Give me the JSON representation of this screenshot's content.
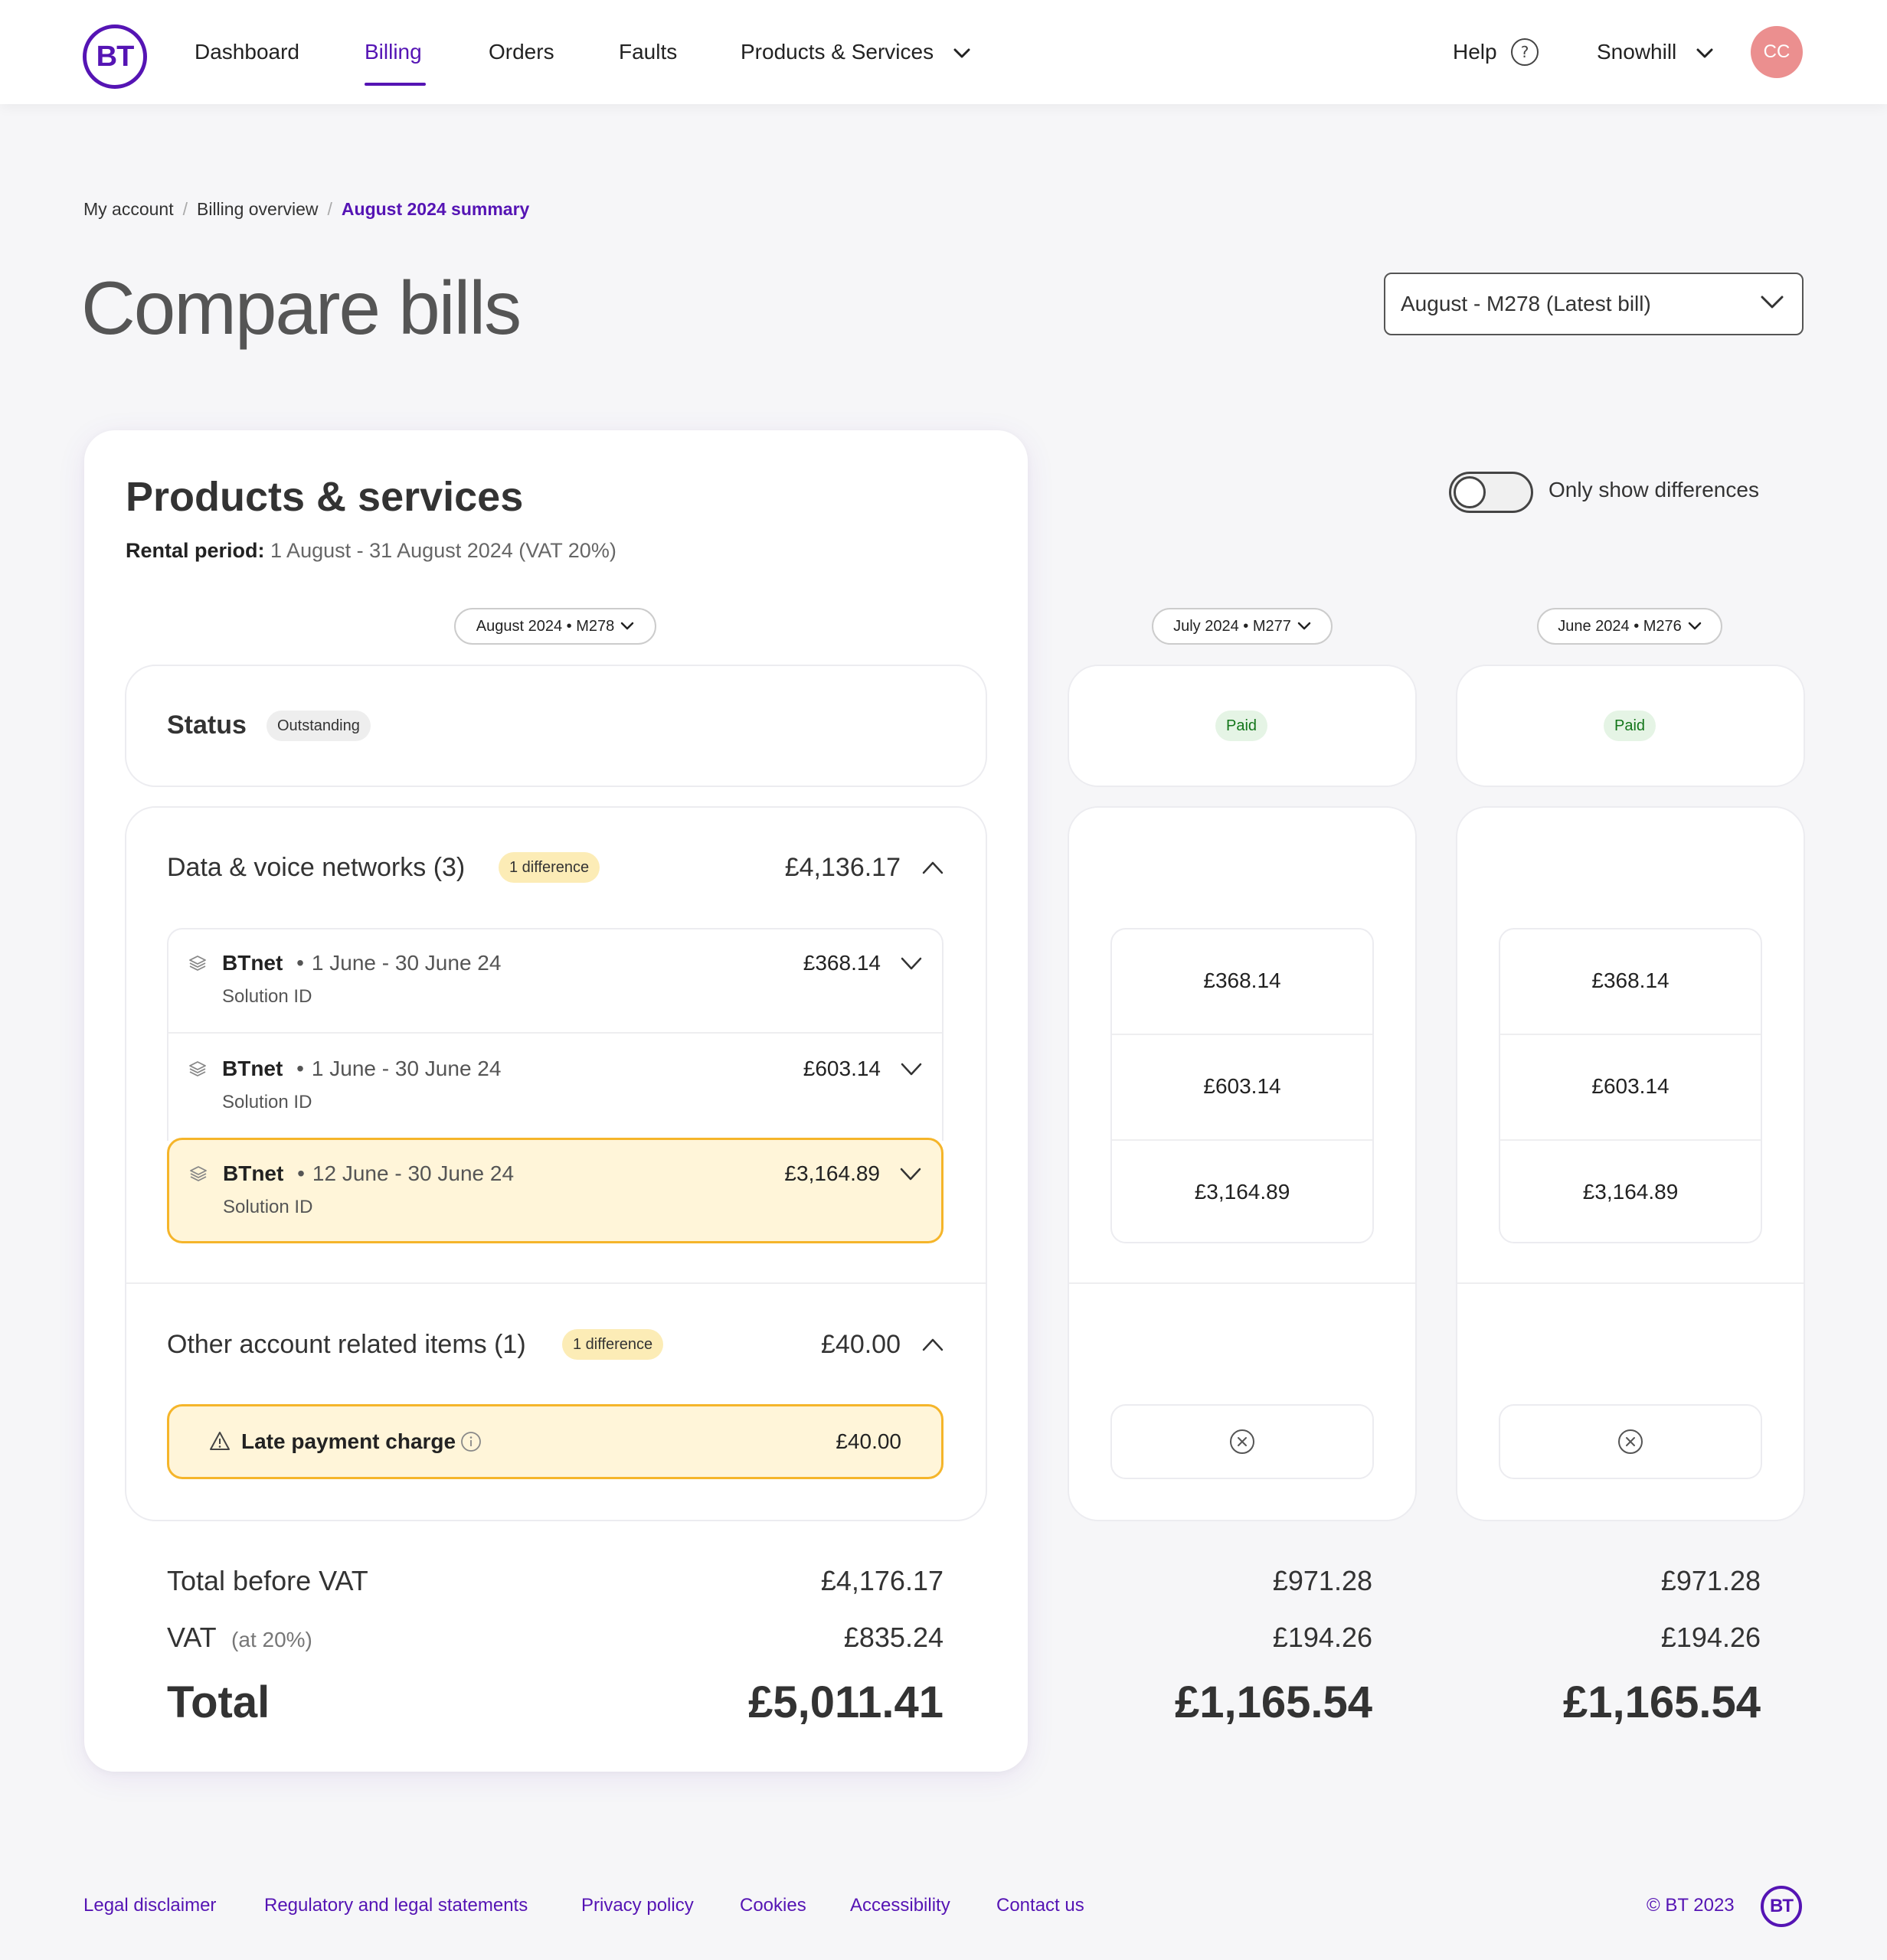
{
  "header": {
    "logo": "BT",
    "nav": [
      {
        "label": "Dashboard"
      },
      {
        "label": "Billing"
      },
      {
        "label": "Orders"
      },
      {
        "label": "Faults"
      },
      {
        "label": "Products & Services"
      }
    ],
    "help": "Help",
    "account": "Snowhill",
    "avatar_initials": "CC",
    "brand_color": "#5514b4"
  },
  "breadcrumb": {
    "items": [
      "My account",
      "Billing overview"
    ],
    "current": "August 2024 summary"
  },
  "page": {
    "title": "Compare bills",
    "bill_select": "August - M278 (Latest bill)"
  },
  "products": {
    "title": "Products & services",
    "rental_label": "Rental period:",
    "rental_value": "1 August - 31 August 2024 (VAT 20%)",
    "toggle_label": "Only show differences",
    "toggle_on": false
  },
  "columns": [
    {
      "label": "August 2024 • M278",
      "status": "Outstanding"
    },
    {
      "label": "July 2024 • M277",
      "status": "Paid"
    },
    {
      "label": "June 2024 • M276",
      "status": "Paid"
    }
  ],
  "status_label": "Status",
  "data_voice": {
    "title": "Data & voice networks (3)",
    "badge": "1 difference",
    "total": "£4,136.17",
    "items": [
      {
        "name": "BTnet",
        "bullet": "•",
        "period": "1 June - 30 June 24",
        "sub": "Solution ID",
        "amount": "£368.14",
        "july": "£368.14",
        "june": "£368.14"
      },
      {
        "name": "BTnet",
        "bullet": "•",
        "period": "1 June - 30 June 24",
        "sub": "Solution ID",
        "amount": "£603.14",
        "july": "£603.14",
        "june": "£603.14"
      },
      {
        "name": "BTnet",
        "bullet": "•",
        "period": "12 June - 30 June 24",
        "sub": "Solution ID",
        "amount": "£3,164.89",
        "july": "£3,164.89",
        "june": "£3,164.89"
      }
    ]
  },
  "other": {
    "title": "Other account related items (1)",
    "badge": "1 difference",
    "total": "£40.00",
    "item_name": "Late payment charge",
    "item_amount": "£40.00"
  },
  "totals": {
    "before_vat_label": "Total before VAT",
    "vat_label": "VAT",
    "vat_note": "(at 20%)",
    "total_label": "Total",
    "aug": {
      "before_vat": "£4,176.17",
      "vat": "£835.24",
      "total": "£5,011.41"
    },
    "jul": {
      "before_vat": "£971.28",
      "vat": "£194.26",
      "total": "£1,165.54"
    },
    "jun": {
      "before_vat": "£971.28",
      "vat": "£194.26",
      "total": "£1,165.54"
    }
  },
  "footer": {
    "links": [
      "Legal disclaimer",
      "Regulatory and legal statements",
      "Privacy policy",
      "Cookies",
      "Accessibility",
      "Contact us"
    ],
    "copyright": "© BT 2023",
    "logo": "BT"
  }
}
